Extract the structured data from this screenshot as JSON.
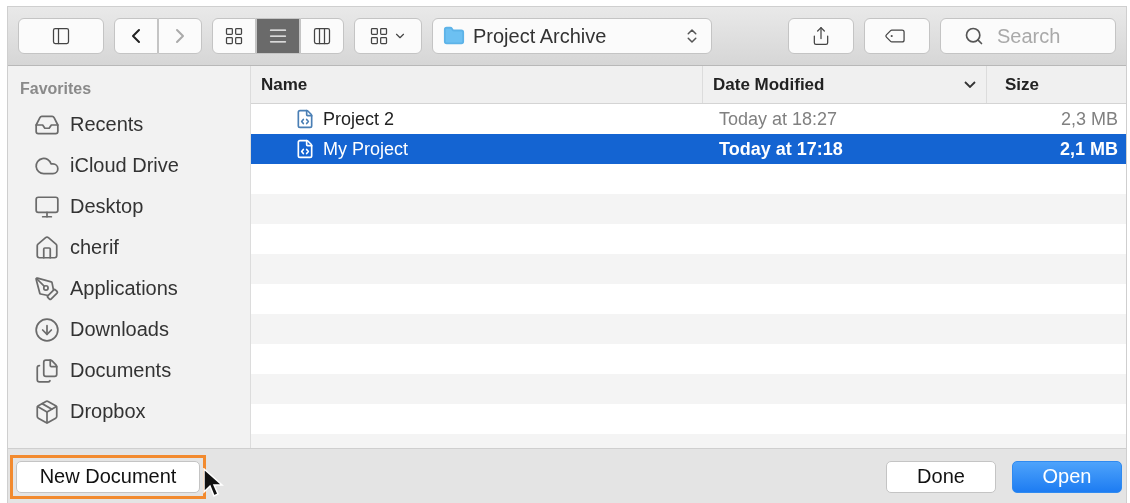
{
  "toolbar": {
    "views": [
      {
        "kind": "icons",
        "selected": false
      },
      {
        "kind": "list",
        "selected": true
      },
      {
        "kind": "columns",
        "selected": false
      }
    ],
    "back_enabled": true,
    "forward_enabled": false,
    "location": "Project Archive",
    "search": {
      "placeholder": "Search"
    }
  },
  "sidebar": {
    "heading": "Favorites",
    "items": [
      {
        "kind": "recents",
        "label": "Recents"
      },
      {
        "kind": "cloud",
        "label": "iCloud Drive"
      },
      {
        "kind": "desktop",
        "label": "Desktop"
      },
      {
        "kind": "home",
        "label": "cherif"
      },
      {
        "kind": "applications",
        "label": "Applications"
      },
      {
        "kind": "downloads",
        "label": "Downloads"
      },
      {
        "kind": "documents",
        "label": "Documents"
      },
      {
        "kind": "dropbox",
        "label": "Dropbox"
      }
    ]
  },
  "table": {
    "columns": [
      {
        "label": "Name",
        "sorted": false
      },
      {
        "label": "Date Modified",
        "sorted": true
      },
      {
        "label": "Size",
        "sorted": false
      }
    ],
    "rows": [
      {
        "name": "Project 2",
        "date": "Today at 18:27",
        "size": "2,3 MB",
        "selected": false
      },
      {
        "name": "My Project",
        "date": "Today at 17:18",
        "size": "2,1 MB",
        "selected": true
      }
    ]
  },
  "footer": {
    "new_button": {
      "label": "New Document",
      "highlighted": true
    },
    "buttons": [
      {
        "label": "Done",
        "default": false
      },
      {
        "label": "Open",
        "default": true
      }
    ]
  }
}
